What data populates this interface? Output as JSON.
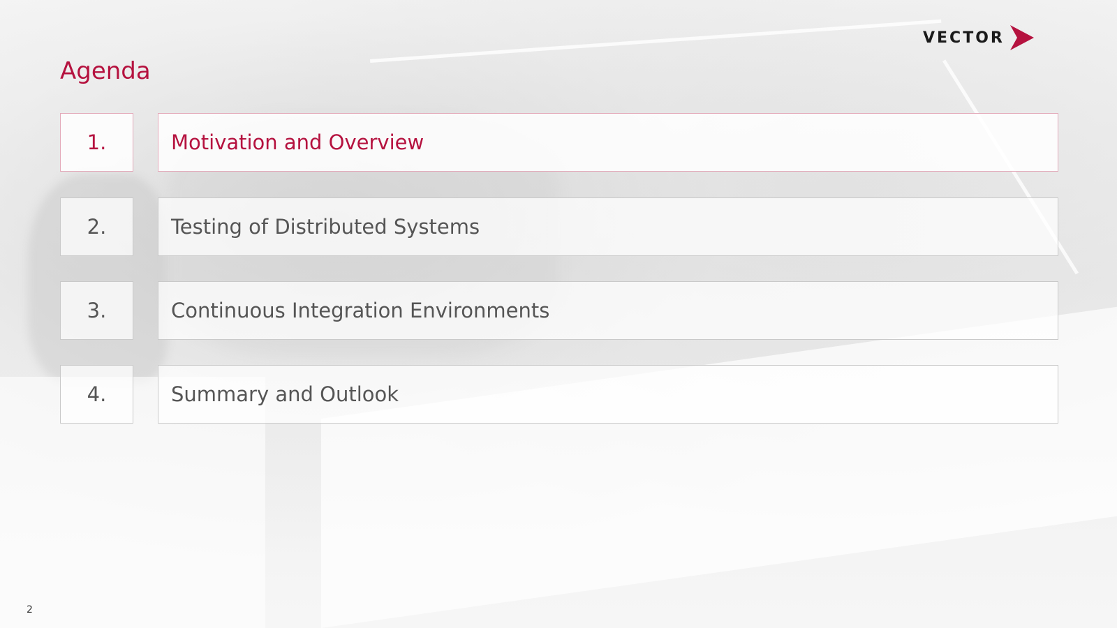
{
  "header": {
    "logo_text": "VECTOR",
    "title": "Agenda"
  },
  "agenda": {
    "items": [
      {
        "number": "1.",
        "label": "Motivation and Overview",
        "active": true
      },
      {
        "number": "2.",
        "label": "Testing of Distributed Systems",
        "active": false
      },
      {
        "number": "3.",
        "label": "Continuous Integration Environments",
        "active": false
      },
      {
        "number": "4.",
        "label": "Summary and Outlook",
        "active": false
      }
    ]
  },
  "footer": {
    "page_number": "2"
  },
  "colors": {
    "accent": "#b5123f",
    "text": "#555555",
    "border": "#c9c9c9"
  },
  "icons": {
    "logo_mark": "chevron-right-icon"
  }
}
